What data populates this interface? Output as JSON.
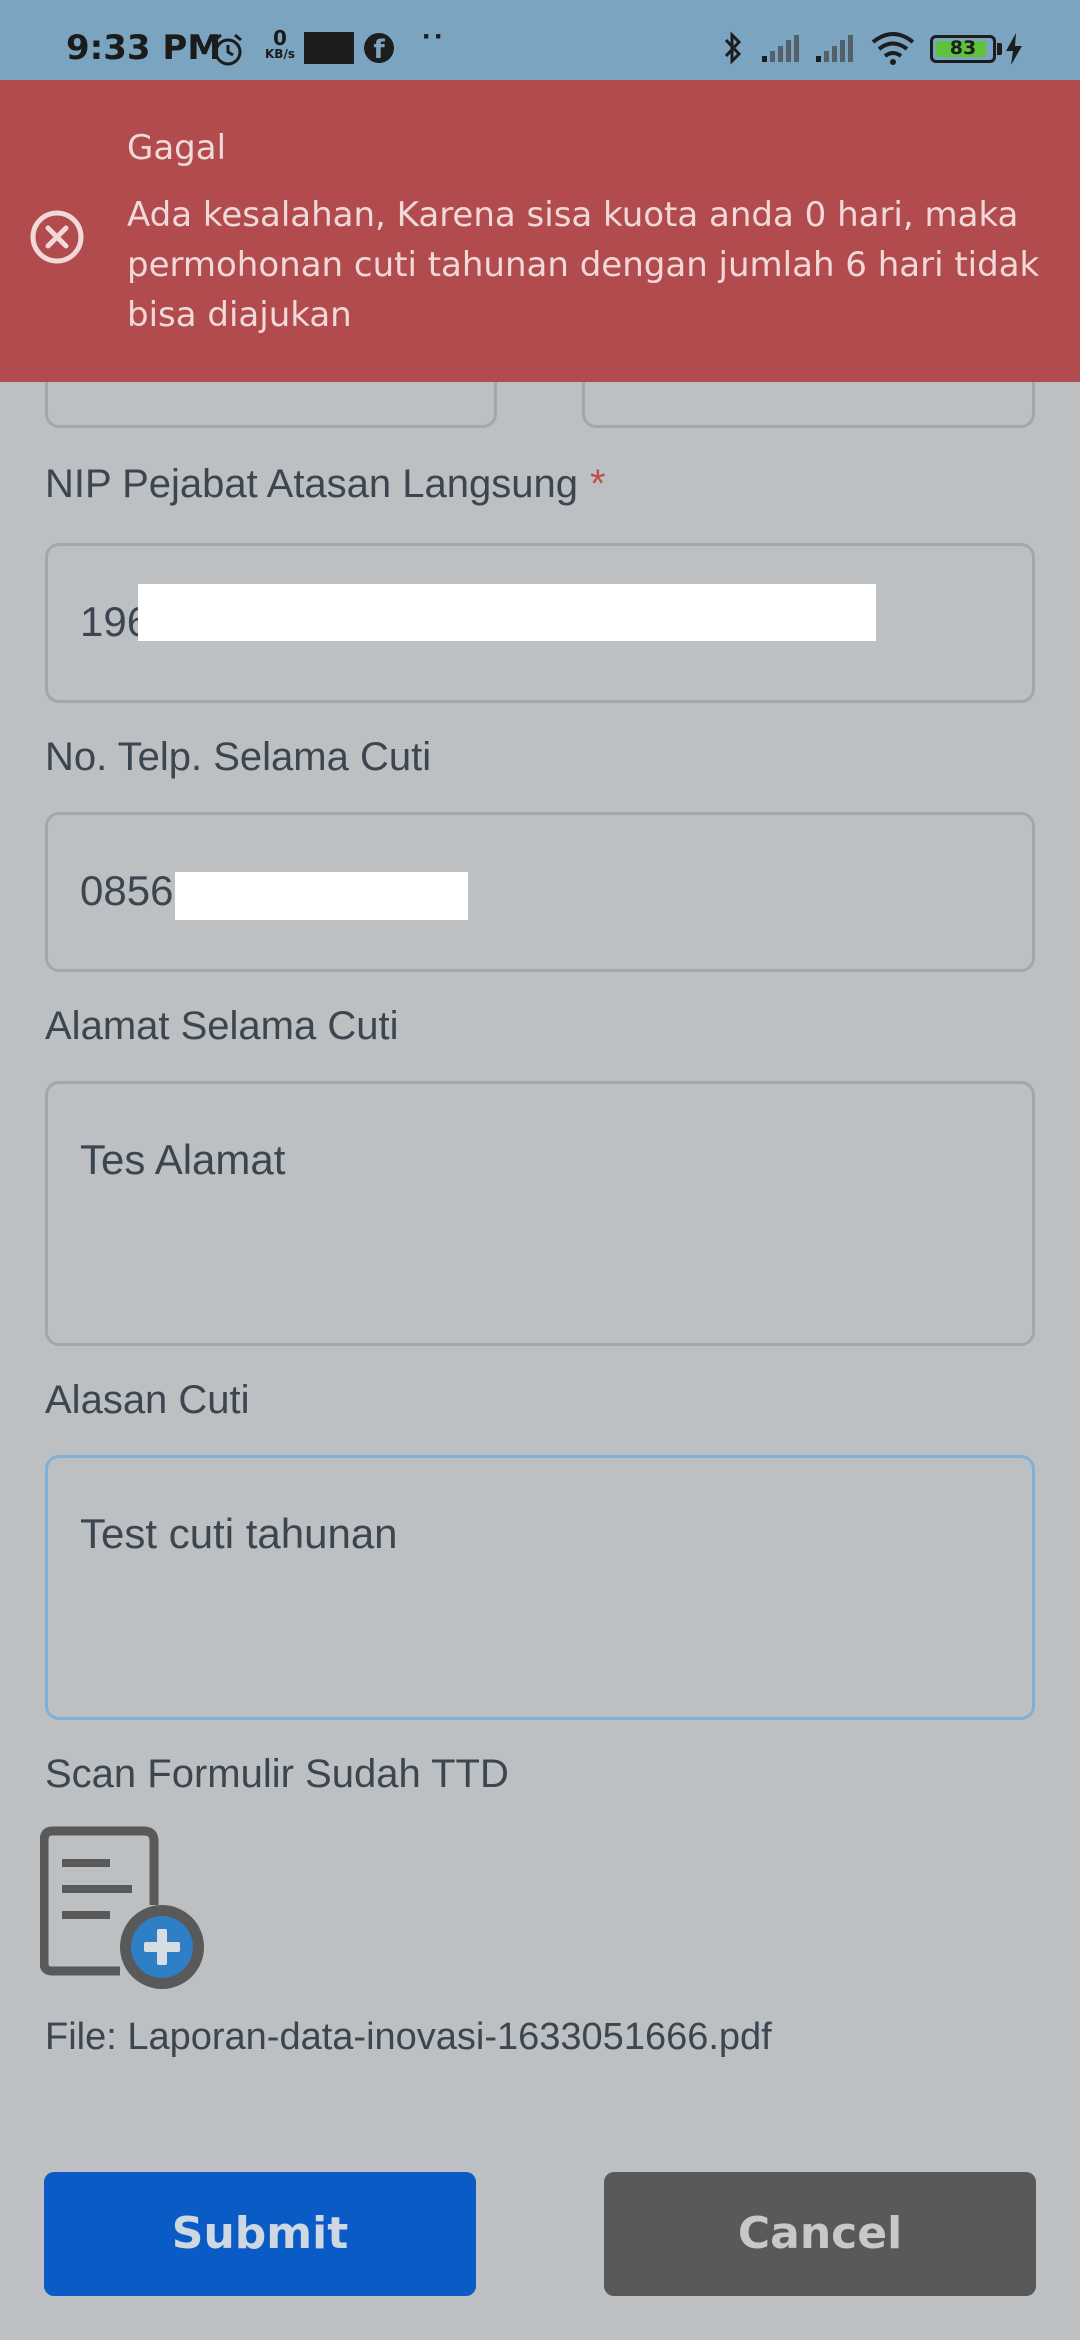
{
  "status_bar": {
    "time": "9:33 PM",
    "net_speed_value": "0",
    "net_speed_unit": "KB/s",
    "battery_level": "83",
    "icons": [
      "alarm-icon",
      "facebook-icon",
      "bluetooth-icon",
      "signal-icon",
      "wifi-icon",
      "battery-icon",
      "charging-icon"
    ]
  },
  "toast": {
    "title": "Gagal",
    "message": "Ada kesalahan, Karena sisa kuota anda 0 hari, maka permohonan cuti tahunan dengan jumlah 6 hari tidak bisa diajukan",
    "color": "#b24b4d"
  },
  "form": {
    "nip_label": "NIP Pejabat Atasan Langsung",
    "required_mark": "*",
    "nip_value": "196",
    "phone_label": "No. Telp. Selama Cuti",
    "phone_value": "0856",
    "address_label": "Alamat Selama Cuti",
    "address_value": "Tes Alamat",
    "reason_label": "Alasan Cuti",
    "reason_value": "Test cuti tahunan",
    "scan_label": "Scan Formulir Sudah TTD",
    "file_text": "File: Laporan-data-inovasi-1633051666.pdf"
  },
  "actions": {
    "submit_label": "Submit",
    "cancel_label": "Cancel",
    "submit_color": "#0a5bc6",
    "cancel_color": "#595959"
  }
}
